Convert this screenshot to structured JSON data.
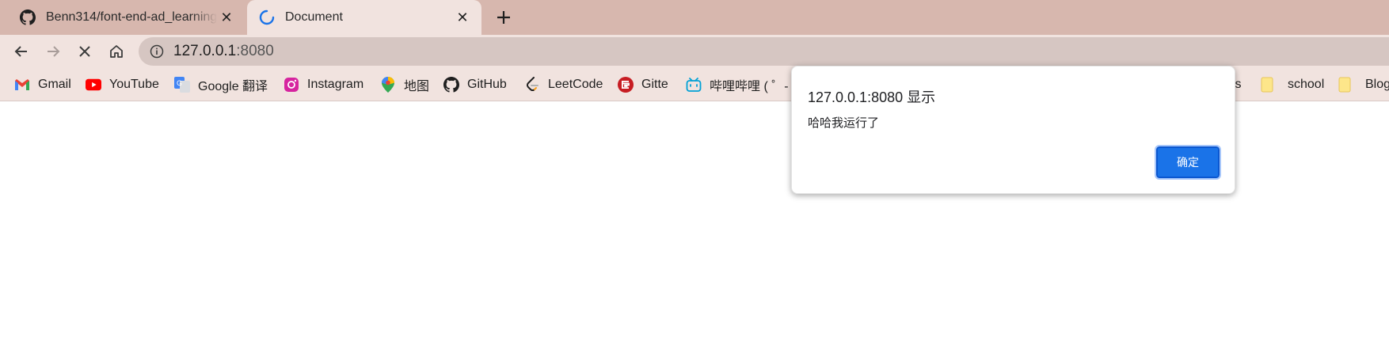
{
  "tabs": [
    {
      "title": "Benn314/font-end-ad_learning",
      "favicon": "github-icon",
      "active": false
    },
    {
      "title": "Document",
      "favicon": "loading-spinner-icon",
      "active": true
    }
  ],
  "toolbar": {
    "url_host": "127.0.0.1",
    "url_port": ":8080"
  },
  "bookmarks": [
    {
      "label": "Gmail",
      "icon": "gmail-icon"
    },
    {
      "label": "YouTube",
      "icon": "youtube-icon"
    },
    {
      "label": "Google 翻译",
      "icon": "google-translate-icon"
    },
    {
      "label": "Instagram",
      "icon": "instagram-icon"
    },
    {
      "label": "地图",
      "icon": "maps-icon"
    },
    {
      "label": "GitHub",
      "icon": "github-icon"
    },
    {
      "label": "LeetCode",
      "icon": "leetcode-icon"
    },
    {
      "label": "Gitte",
      "icon": "gitee-icon"
    },
    {
      "label": "哔哩哔哩 ( ゜- ゜",
      "icon": "bilibili-icon"
    },
    {
      "label": "ls",
      "icon": "folder-icon"
    },
    {
      "label": "school",
      "icon": "folder-icon"
    },
    {
      "label": "Blog",
      "icon": "folder-icon"
    }
  ],
  "dialog": {
    "title": "127.0.0.1:8080 显示",
    "message": "哈哈我运行了",
    "ok_label": "确定"
  },
  "colors": {
    "tabstrip": "#d7b7ae",
    "toolbar": "#f1e3df",
    "omnibox": "#d6c6c2",
    "accent": "#1a73e8"
  }
}
